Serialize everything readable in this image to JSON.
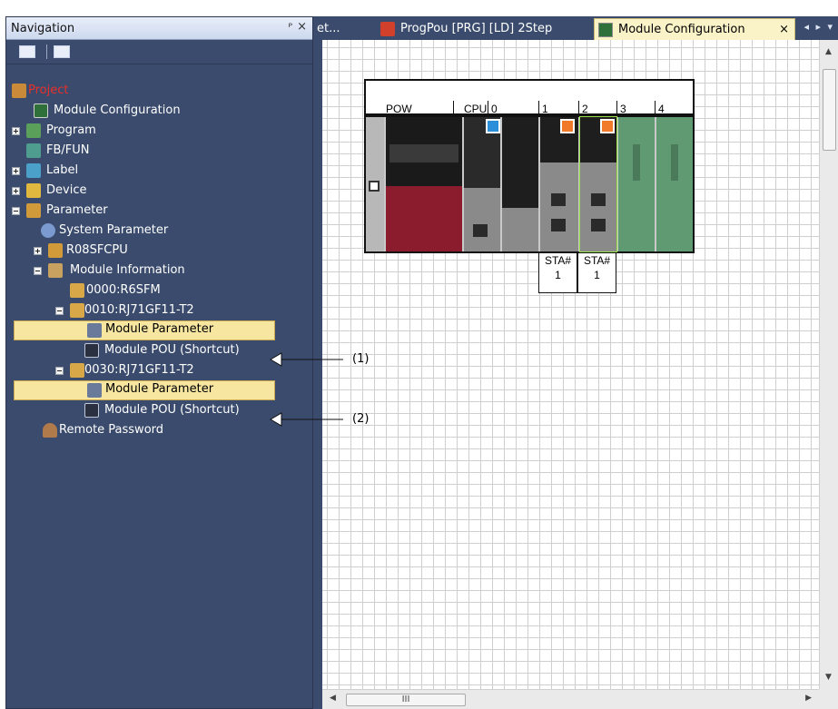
{
  "navigation": {
    "title": "Navigation",
    "pin_glyph": "ᴾ",
    "close_glyph": "×",
    "tree": [
      {
        "label": "Project"
      },
      {
        "label": "Module Configuration"
      },
      {
        "label": "Program"
      },
      {
        "label": "FB/FUN"
      },
      {
        "label": "Label"
      },
      {
        "label": "Device"
      },
      {
        "label": "Parameter"
      },
      {
        "label": "System Parameter"
      },
      {
        "label": "R08SFCPU"
      },
      {
        "label": "Module Information"
      },
      {
        "label": "0000:R6SFM"
      },
      {
        "label": "0010:RJ71GF11-T2"
      },
      {
        "label": "Module Parameter"
      },
      {
        "label": "Module POU (Shortcut)"
      },
      {
        "label": "0030:RJ71GF11-T2"
      },
      {
        "label": "Module Parameter"
      },
      {
        "label": "Module POU (Shortcut)"
      },
      {
        "label": "Remote Password"
      }
    ]
  },
  "tabs": [
    {
      "label": "et..."
    },
    {
      "label": "ProgPou [PRG] [LD] 2Step"
    },
    {
      "label": "Module Configuration"
    }
  ],
  "tab_close": "×",
  "tab_scroll": "◂ ▸ ▾",
  "rack": {
    "slots": [
      "POW",
      "CPU",
      "0",
      "1",
      "2",
      "3",
      "4"
    ],
    "station_labels": [
      {
        "top": "STA#",
        "bottom": "1"
      },
      {
        "top": "STA#",
        "bottom": "1"
      }
    ]
  },
  "callouts": [
    "(1)",
    "(2)"
  ],
  "hscroll_grip": "III",
  "colors": {
    "nav_background": "#3a4b6d",
    "selection": "#f7e6a0",
    "project_red": "#e8302a",
    "cpu_marker": "#2a8fd8",
    "station_marker": "#f07a2a"
  }
}
